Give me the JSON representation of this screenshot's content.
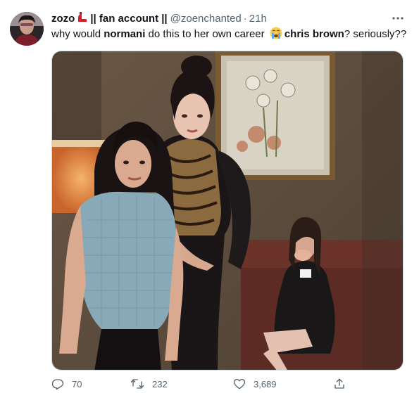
{
  "author": {
    "display_name": "zozo",
    "name_suffix": "|| fan account ||",
    "handle": "@zoenchanted",
    "separator": "·",
    "time": "21h",
    "avatar_icon": "user-avatar",
    "badge_icon": "red-shoe-icon"
  },
  "tweet": {
    "text_before": "why would ",
    "bold_1": "normani",
    "text_mid": " do this to her own career ",
    "emoji_icon": "crying-face-icon",
    "bold_2": "chris brown",
    "text_after": "? seriously??"
  },
  "media": {
    "type": "photo",
    "description_icon": "photo-of-three-women-in-living-room"
  },
  "actions": {
    "reply_count": "70",
    "retweet_count": "232",
    "like_count": "3,689",
    "reply_icon": "reply-icon",
    "retweet_icon": "retweet-icon",
    "like_icon": "heart-icon",
    "share_icon": "share-icon"
  },
  "colors": {
    "text_primary": "#0f1419",
    "text_secondary": "#536471",
    "border": "#cfd9de"
  }
}
